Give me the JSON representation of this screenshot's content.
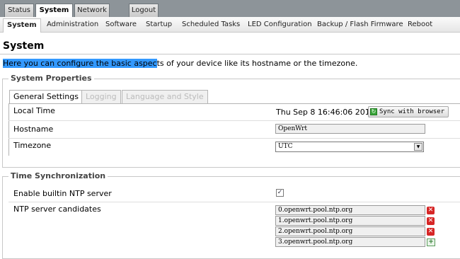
{
  "top_tabs": [
    "Status",
    "System",
    "Network",
    "Logout"
  ],
  "submenu": [
    "System",
    "Administration",
    "Software",
    "Startup",
    "Scheduled Tasks",
    "LED Configuration",
    "Backup / Flash Firmware",
    "Reboot"
  ],
  "page": {
    "title": "System",
    "description_selected": "Here you can configure the basic aspec",
    "description_rest": "ts of your device like its hostname or the timezone."
  },
  "system_properties": {
    "legend": "System Properties",
    "tabs": [
      "General Settings",
      "Logging",
      "Language and Style"
    ],
    "local_time_label": "Local Time",
    "local_time_value": "Thu Sep 8 16:46:06 2011",
    "sync_button": "Sync with browser",
    "hostname_label": "Hostname",
    "hostname_value": "OpenWrt",
    "timezone_label": "Timezone",
    "timezone_value": "UTC"
  },
  "time_sync": {
    "legend": "Time Synchronization",
    "ntp_enable_label": "Enable builtin NTP server",
    "ntp_enable_checked": true,
    "ntp_candidates_label": "NTP server candidates",
    "servers": [
      "0.openwrt.pool.ntp.org",
      "1.openwrt.pool.ntp.org",
      "2.openwrt.pool.ntp.org",
      "3.openwrt.pool.ntp.org"
    ]
  }
}
